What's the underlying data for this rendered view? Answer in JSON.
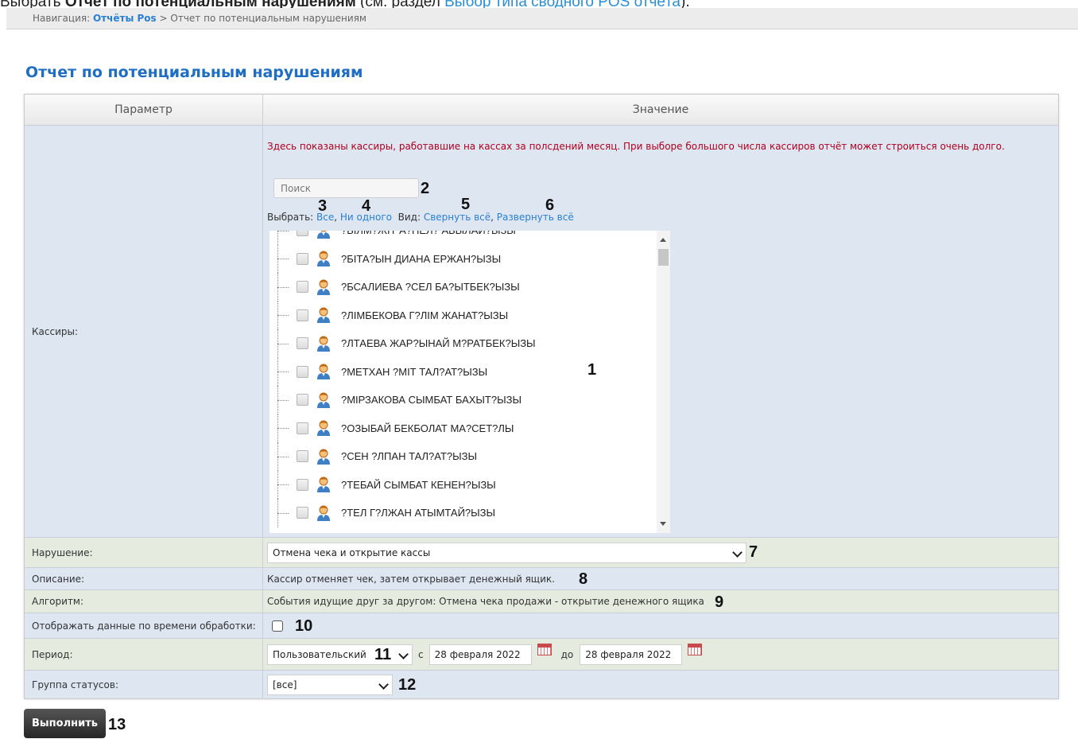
{
  "doc": {
    "pre": "Выбрать ",
    "bold": "Отчёт по потенциальным нарушениям",
    "mid": " (см. раздел ",
    "link": "Выбор типа сводного POS отчёта",
    "post": ")."
  },
  "nav": {
    "label": "Навигация:",
    "root": "Отчёты Pos",
    "sep": ">",
    "current": "Отчет по потенциальным нарушениям"
  },
  "title": "Отчет по потенциальным нарушениям",
  "table": {
    "header_param": "Параметр",
    "header_value": "Значение"
  },
  "cashiers": {
    "label": "Кассиры:",
    "warning": "Здесь показаны кассиры, работавшие на кассах за полсдений месяц. При выборе большого числа кассиров отчёт может строиться очень долго.",
    "search_placeholder": "Поиск",
    "select_label": "Выбрать:",
    "all": "Все",
    "none": "Ни одного",
    "view_label": "Вид:",
    "collapse": "Свернуть всё",
    "expand": "Развернуть всё",
    "list": [
      "?БІЛМ?ЖІТ А?НЕЛ? АБЫЛАЙ?ЫЗЫ",
      "?БІТА?ЫН ДИАНА ЕРЖАН?ЫЗЫ",
      "?БСАЛИЕВА ?СЕЛ БА?ЫТБЕК?ЫЗЫ",
      "?ЛІМБЕКОВА Г?ЛІМ ЖАНАТ?ЫЗЫ",
      "?ЛТАЕВА ЖАР?ЫНАЙ М?РАТБЕК?ЫЗЫ",
      "?МЕТХАН ?МІТ ТАЛ?АТ?ЫЗЫ",
      "?МІРЗАКОВА СЫМБАТ БАХЫТ?ЫЗЫ",
      "?ОЗЫБАЙ БЕКБОЛАТ МА?СЕТ?ЛЫ",
      "?СЕН ?ЛПАН ТАЛ?АТ?ЫЗЫ",
      "?ТЕБАЙ СЫМБАТ КЕНЕН?ЫЗЫ",
      "?ТЕЛ Г?ЛЖАН АТЫМТАЙ?ЫЗЫ"
    ]
  },
  "violation": {
    "label": "Нарушение:",
    "value": "Отмена чека и открытие кассы"
  },
  "description": {
    "label": "Описание:",
    "value": "Кассир отменяет чек, затем открывает денежный ящик."
  },
  "algorithm": {
    "label": "Алгоритм:",
    "value": "События идущие друг за другом: Отмена чека продажи - открытие денежного ящика"
  },
  "process_time": {
    "label": "Отображать данные по времени обработки:",
    "checked": false
  },
  "period": {
    "label": "Период:",
    "value": "Пользовательский",
    "from_label": "с",
    "from_date": "28 февраля 2022",
    "to_label": "до",
    "to_date": "28 февраля 2022"
  },
  "status_group": {
    "label": "Группа статусов:",
    "value": "[все]"
  },
  "run_button": "Выполнить",
  "callouts": [
    "1",
    "2",
    "3",
    "4",
    "5",
    "6",
    "7",
    "8",
    "9",
    "10",
    "11",
    "12",
    "13"
  ],
  "colors": {
    "title": "#1e6ec4",
    "link": "#2a80d2",
    "warning": "#b2001e",
    "row_blue": "#dde6f1",
    "row_green": "#e5ecdf"
  },
  "icons": {
    "cashier": "user-icon",
    "calendar": "calendar-icon",
    "dropdown": "chevron-down-icon"
  }
}
